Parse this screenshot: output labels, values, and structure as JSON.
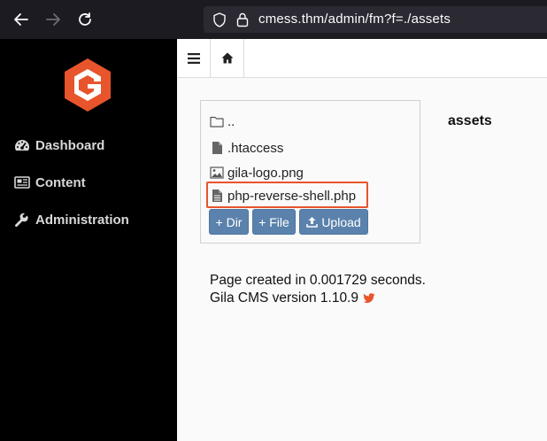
{
  "browser": {
    "url": "cmess.thm/admin/fm?f=./assets"
  },
  "sidebar": {
    "items": [
      {
        "label": "Dashboard",
        "icon": "tachometer-icon"
      },
      {
        "label": "Content",
        "icon": "newspaper-icon"
      },
      {
        "label": "Administration",
        "icon": "wrench-icon"
      }
    ]
  },
  "file_manager": {
    "current_dir": "assets",
    "entries": [
      {
        "name": "..",
        "icon": "folder-icon"
      },
      {
        "name": ".htaccess",
        "icon": "file-icon"
      },
      {
        "name": "gila-logo.png",
        "icon": "image-file-icon"
      },
      {
        "name": "php-reverse-shell.php",
        "icon": "file-text-icon",
        "highlighted": true
      }
    ],
    "buttons": {
      "new_dir": "+ Dir",
      "new_file": "+ File",
      "upload": "Upload"
    }
  },
  "footer": {
    "created": "Page created in 0.001729 seconds.",
    "version": "Gila CMS version 1.10.9"
  },
  "colors": {
    "accent": "#e8542b",
    "button": "#5b82ac",
    "sidebar": "#000000",
    "logo": "#e8542b"
  }
}
